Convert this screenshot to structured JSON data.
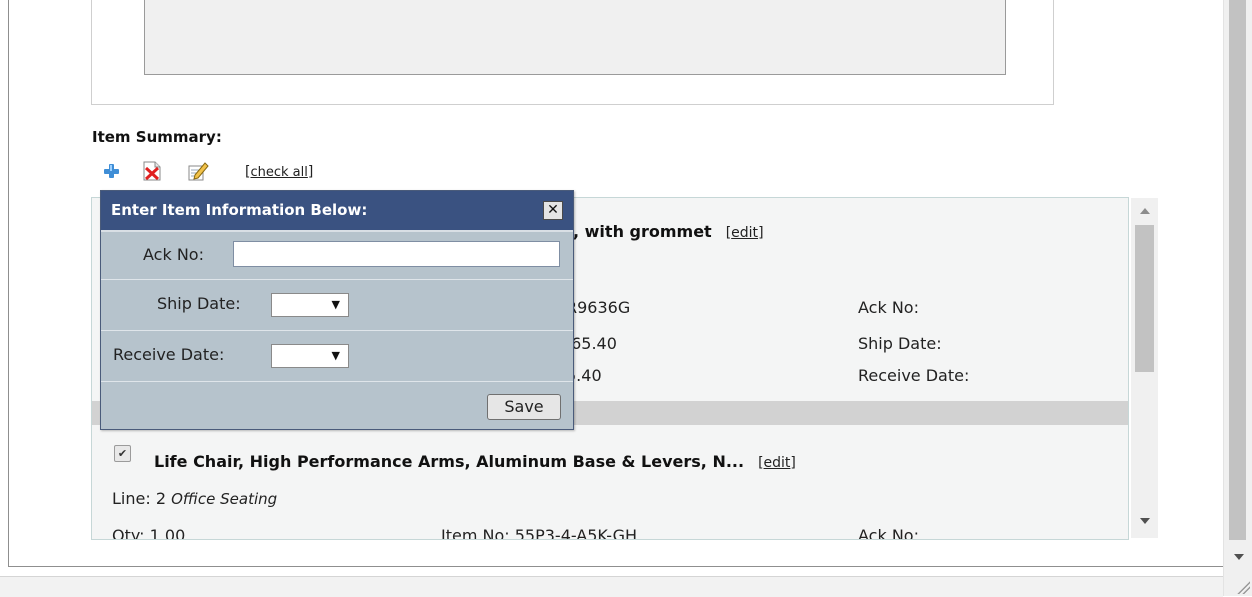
{
  "section": {
    "title": "Item Summary:",
    "check_all": "check all"
  },
  "items": [
    {
      "title": ", with grommet",
      "edit": "edit",
      "col2": [
        "R9636G",
        ".65.40",
        "5.40"
      ],
      "col3": [
        "Ack No:",
        "Ship Date:",
        "Receive Date:"
      ]
    },
    {
      "title": "Life Chair, High Performance Arms, Aluminum Base & Levers, N...",
      "edit": "edit",
      "line": "Line: 2",
      "category": "Office Seating",
      "qty": "Qty: 1.00",
      "item_no": "Item No: 55P3-4-A5K-GH",
      "ack": "Ack No:"
    }
  ],
  "popup": {
    "title": "Enter Item Information Below:",
    "close": "✕",
    "ack_label": "Ack No:",
    "ack_value": "",
    "ship_label": "Ship Date:",
    "receive_label": "Receive Date:",
    "select_value": "",
    "save": "Save"
  },
  "icons": {
    "add": "add-icon",
    "delete": "delete-icon",
    "edit": "edit-icon"
  },
  "colors": {
    "popup_header": "#3a5281",
    "popup_body": "#b6c3cc",
    "panel_bg": "#f4f5f5"
  }
}
